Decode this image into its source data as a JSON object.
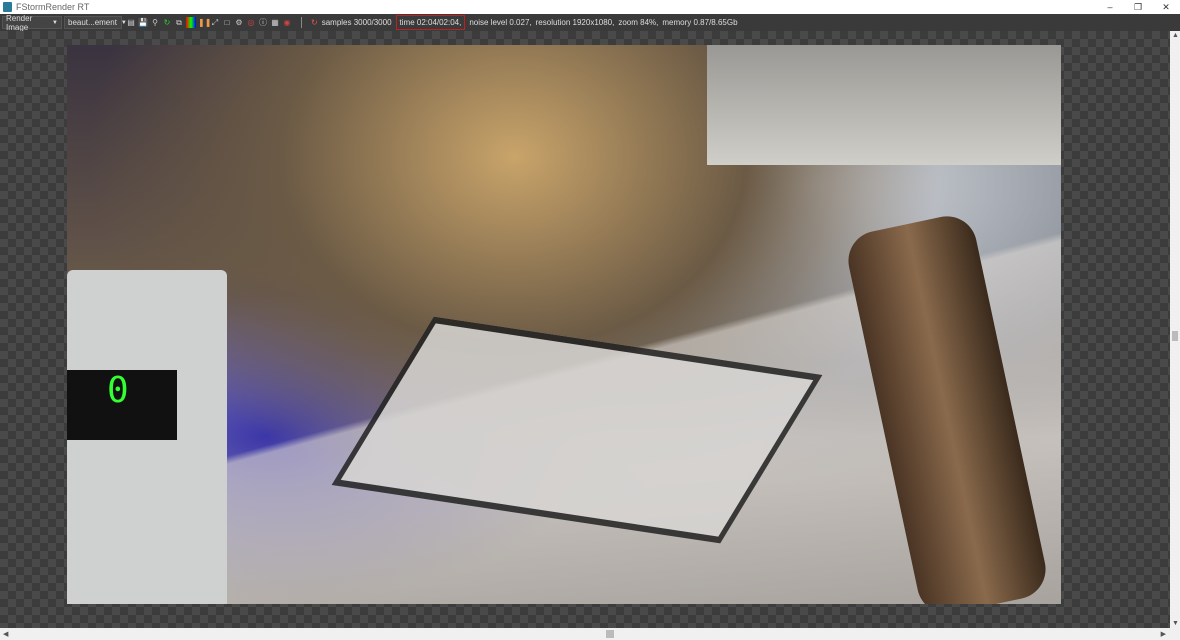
{
  "window": {
    "title": "FStormRender RT",
    "controls": [
      "minimize",
      "restore",
      "close"
    ]
  },
  "toolbar": {
    "mode_select": "Render Image",
    "channel_select": "beaut...ement",
    "tools": [
      "fit-icon",
      "save-icon",
      "zoom-icon",
      "refresh-icon",
      "copy-icon",
      "color-icon",
      "pause-icon",
      "fullscreen-icon",
      "region-icon",
      "settings-icon",
      "target-icon",
      "info-icon",
      "grid-icon",
      "denoise-icon"
    ]
  },
  "status": {
    "samples": "samples 3000/3000",
    "time": "time 02:04/02:04,",
    "noise": "noise level 0.027,",
    "resolution": "resolution 1920x1080,",
    "zoom": "zoom 84%,",
    "memory": "memory 0.87/8.65Gb"
  },
  "render": {
    "microwave_display": "0"
  }
}
